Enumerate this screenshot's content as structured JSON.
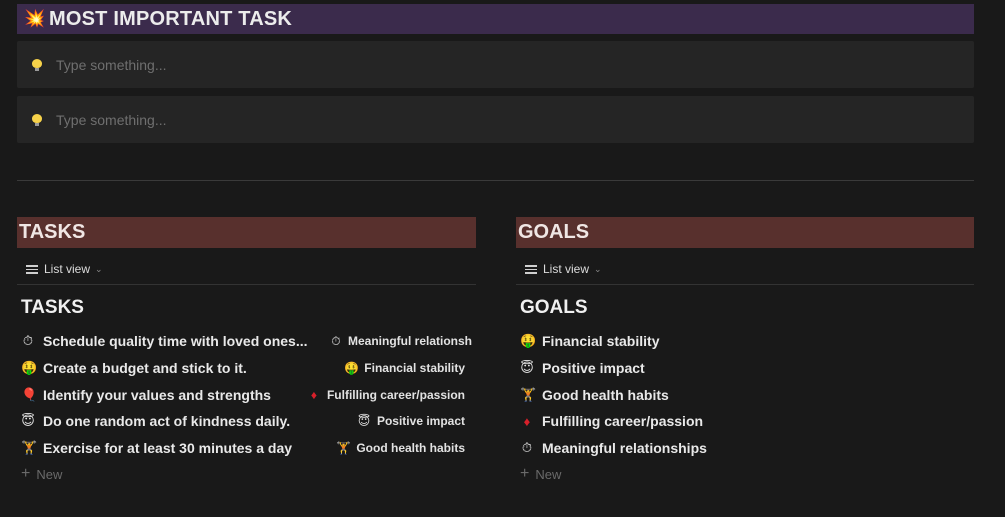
{
  "banner": {
    "emoji": "💥",
    "title": "MOST IMPORTANT TASK"
  },
  "inputs": [
    {
      "placeholder": "Type something..."
    },
    {
      "placeholder": "Type something..."
    }
  ],
  "tasks": {
    "header": "TASKS",
    "view_label": "List view",
    "list_title": "TASKS",
    "items": [
      {
        "icon": "⏱",
        "text": "Schedule quality time with loved ones...",
        "rel_icon": "⏱",
        "rel": "Meaningful relationsh"
      },
      {
        "icon": "🤑",
        "text": "Create a budget and stick to it.",
        "rel_icon": "🤑",
        "rel": "Financial stability"
      },
      {
        "icon": "🎈",
        "text": "Identify your values and strengths",
        "rel_icon": "♦",
        "rel": "Fulfilling career/passion"
      },
      {
        "icon": "😇",
        "text": "Do one random act of kindness daily.",
        "rel_icon": "😇",
        "rel": "Positive impact"
      },
      {
        "icon": "🏋",
        "text": "Exercise for at least 30 minutes a day",
        "rel_icon": "🏋",
        "rel": "Good health habits"
      }
    ],
    "new_label": "New"
  },
  "goals": {
    "header": "GOALS",
    "view_label": "List view",
    "list_title": "GOALS",
    "items": [
      {
        "icon": "🤑",
        "text": "Financial stability"
      },
      {
        "icon": "😇",
        "text": "Positive impact"
      },
      {
        "icon": "🏋",
        "text": "Good health habits"
      },
      {
        "icon": "♦",
        "text": "Fulfilling career/passion"
      },
      {
        "icon": "⏱",
        "text": "Meaningful relationships"
      }
    ],
    "new_label": "New"
  }
}
